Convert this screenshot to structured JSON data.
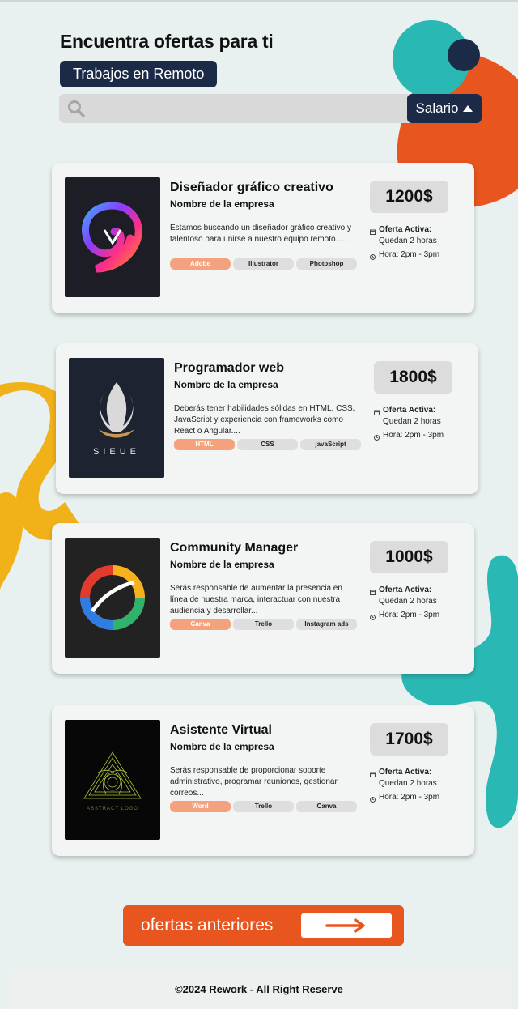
{
  "header": {
    "title": "Encuentra ofertas para ti",
    "category": "Trabajos en Remoto"
  },
  "search": {
    "placeholder": "",
    "icon": "search-icon",
    "sort_label": "Salario",
    "sort_icon": "triangle-up-icon"
  },
  "colors": {
    "navy": "#1b2a47",
    "orange": "#e8551f",
    "teal": "#2ab8b4",
    "yellow": "#f1b119",
    "tag_primary": "#f3a27d"
  },
  "jobs": [
    {
      "title": "Diseñador gráfico creativo",
      "company": "Nombre de la empresa",
      "description": "Estamos buscando un diseñador gráfico creativo y talentoso para unirse a nuestro equipo remoto......",
      "tags": [
        "Adobe",
        "Illustrator",
        "Photoshop"
      ],
      "salary": "1200$",
      "status_label": "Oferta Activa:",
      "remaining": "Quedan 2 horas",
      "hours": "Hora: 2pm - 3pm"
    },
    {
      "title": "Programador web",
      "company": "Nombre de la empresa",
      "description": "Deberás tener habilidades sólidas en HTML, CSS, JavaScript y experiencia con frameworks como React o Angular....",
      "tags": [
        "HTML",
        "CSS",
        "javaScript"
      ],
      "salary": "1800$",
      "status_label": "Oferta Activa:",
      "remaining": "Quedan 2 horas",
      "hours": "Hora: 2pm - 3pm",
      "logo_text": "SIEUE"
    },
    {
      "title": "Community Manager",
      "company": "Nombre de la empresa",
      "description": "Serás responsable de aumentar la presencia en línea de nuestra marca, interactuar con nuestra audiencia y desarrollar...",
      "tags": [
        "Canva",
        "Trello",
        "Instagram ads"
      ],
      "salary": "1000$",
      "status_label": "Oferta Activa:",
      "remaining": "Quedan 2 horas",
      "hours": "Hora: 2pm - 3pm"
    },
    {
      "title": "Asistente Virtual",
      "company": "Nombre de la empresa",
      "description": "Serás responsable de proporcionar soporte administrativo, programar reuniones, gestionar correos...",
      "tags": [
        "Word",
        "Trello",
        "Canva"
      ],
      "salary": "1700$",
      "status_label": "Oferta Activa:",
      "remaining": "Quedan 2 horas",
      "hours": "Hora: 2pm - 3pm",
      "logo_text": "ABSTRACT LOGO"
    }
  ],
  "previous_button": {
    "label": "ofertas anteriores",
    "icon": "arrow-right-icon"
  },
  "footer": {
    "copyright": "©2024 Rework - All Right Reserve"
  }
}
